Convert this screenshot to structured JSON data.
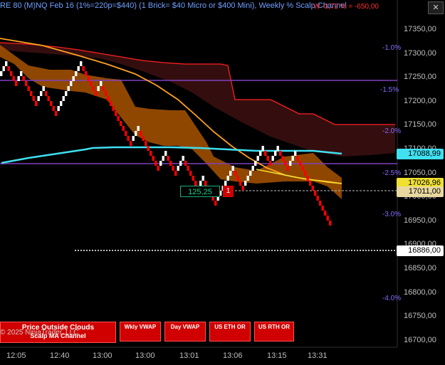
{
  "header": {
    "title": "RE 80 (M)NQ Feb 16 (1%=220p=$440) (1 Brick= $40 Micro or $400 Mini), Weekly %   Scalp Channel",
    "right_text": "W -3,72 % = -650,00",
    "close_label": "✕"
  },
  "price_axis": {
    "labels": [
      "17350,00",
      "17300,00",
      "17250,00",
      "17200,00",
      "17150,00",
      "17100,00",
      "17050,00",
      "17000,00",
      "16950,00",
      "16900,00",
      "16850,00",
      "16800,00",
      "16750,00",
      "16700,00"
    ],
    "tags": [
      {
        "text": "17088,99",
        "bg": "#40e0f0",
        "fg": "#000000"
      },
      {
        "text": "17026,96",
        "bg": "#f0e030",
        "fg": "#000000"
      },
      {
        "text": "17011,00",
        "bg": "#e8d8a0",
        "fg": "#000000"
      },
      {
        "text": "16886,00",
        "bg": "#ffffff",
        "fg": "#000000"
      }
    ]
  },
  "pct_labels": [
    "-1.0%",
    "-1.5%",
    "-2.0%",
    "-2.5%",
    "-3.0%",
    "-4.0%"
  ],
  "time_axis": [
    "12:05",
    "12:40",
    "13:00",
    "13:00",
    "13:01",
    "13:06",
    "13:15",
    "13:31"
  ],
  "position": {
    "value": "125,25",
    "qty": "1"
  },
  "buttons": {
    "price_outside_clouds": "Price Outside Clouds",
    "scalp_ma_channel": "Scalp MA Channel",
    "weekly_vwap": "Wkly VWAP",
    "day_vwap": "Day VWAP",
    "us_eth_or": "US ETH OR",
    "us_rth_or": "US RTH OR"
  },
  "copyright": "© 2025 NinjaTrader, LLC",
  "colors": {
    "up": "#ffffff",
    "down": "#ff0000",
    "cloud_dark": "#3a0f0f",
    "cloud_orange": "#b05a00",
    "vwap_cyan": "#40e0f0",
    "ma_orange": "#ffa020",
    "purple_line": "#8040c0"
  }
}
